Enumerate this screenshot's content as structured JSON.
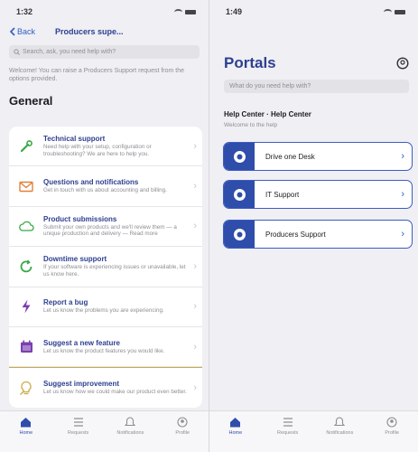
{
  "left_screen": {
    "status_time": "1:32",
    "nav": {
      "back_label": "Back",
      "title": "Producers supe..."
    },
    "search_placeholder": "Search, ask, you need help with?",
    "welcome_text": "Welcome! You can raise a Producers Support request from the options provided.",
    "section_title": "General",
    "request_types": [
      {
        "title": "Technical support",
        "description": "Need help with your setup, configuration or troubleshooting? We are here to help you.",
        "icon": "wrench-icon"
      },
      {
        "title": "Questions and notifications",
        "description": "Get in touch with us about accounting and billing.",
        "icon": "envelope-icon"
      },
      {
        "title": "Product submissions",
        "description": "Submit your own products and we'll review them — a unique production and delivery — Read more",
        "icon": "cloud-icon"
      },
      {
        "title": "Downtime support",
        "description": "If your software is experiencing issues or unavailable, let us know here.",
        "icon": "refresh-icon"
      },
      {
        "title": "Report a bug",
        "description": "Let us know the problems you are experiencing.",
        "icon": "lightning-icon"
      },
      {
        "title": "Suggest a new feature",
        "description": "Let us know the product features you would like.",
        "icon": "calendar-icon"
      },
      {
        "title": "Suggest improvement",
        "description": "Let us know how we could make our product even better.",
        "icon": "lightbulb-icon"
      }
    ]
  },
  "right_screen": {
    "status_time": "1:49",
    "title": "Portals",
    "search_placeholder": "What do you need help with?",
    "help_center_title": "Help Center · Help Center",
    "help_center_subtitle": "Welcome to the help",
    "portals": [
      {
        "label": "Drive one Desk"
      },
      {
        "label": "IT Support"
      },
      {
        "label": "Producers Support"
      }
    ]
  },
  "tabbar": [
    {
      "label": "Home",
      "icon": "home-icon"
    },
    {
      "label": "Requests",
      "icon": "list-icon"
    },
    {
      "label": "Notifications",
      "icon": "bell-icon"
    },
    {
      "label": "Profile",
      "icon": "profile-icon"
    }
  ],
  "colors": {
    "brand": "#2d3f8f",
    "accent": "#2f5fc4",
    "highlight": "#c9ab47",
    "portal_block": "#2f4dab"
  }
}
